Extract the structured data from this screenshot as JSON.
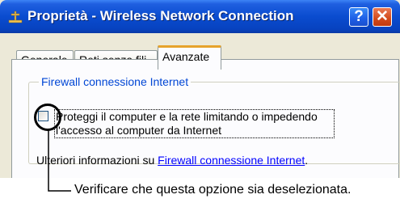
{
  "window": {
    "title": "Proprietà - Wireless Network Connection",
    "help_label": "?",
    "close_label": "✕",
    "title_icon": "network-connection-icon"
  },
  "tabs": [
    {
      "label": "Generale",
      "selected": false
    },
    {
      "label": "Reti senza fili",
      "selected": false
    },
    {
      "label": "Avanzate",
      "selected": true
    }
  ],
  "firewall": {
    "group_title": "Firewall connessione Internet",
    "checkbox_label": "Proteggi il computer e la rete limitando o impedendo l'accesso al computer da Internet",
    "checked": false,
    "info_prefix": "Ulteriori informazioni su ",
    "info_link": "Firewall connessione Internet",
    "info_suffix": "."
  },
  "annotation": {
    "text": "Verificare che questa opzione sia deselezionata."
  },
  "colors": {
    "titlebar": "#0a4ccf",
    "window_bg": "#ece9d8",
    "link": "#0000ff",
    "group_title": "#0046d5",
    "tab_highlight": "#e6a32b",
    "close_button": "#d24a1b",
    "help_button": "#1d5ee6"
  }
}
